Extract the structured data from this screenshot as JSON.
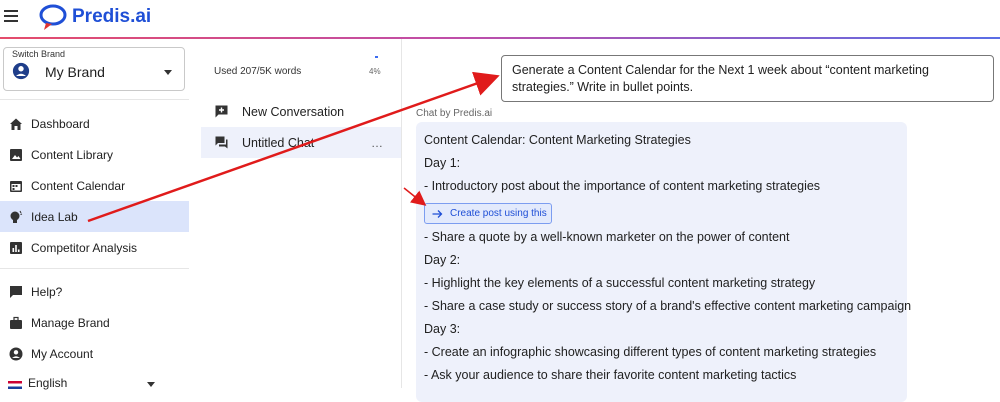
{
  "app": {
    "logo_text": "Predis.ai"
  },
  "brand_switch": {
    "label": "Switch Brand",
    "value": "My Brand"
  },
  "sidebar": {
    "items": [
      {
        "label": "Dashboard",
        "icon": "home-icon"
      },
      {
        "label": "Content Library",
        "icon": "image-library-icon"
      },
      {
        "label": "Content Calendar",
        "icon": "calendar-icon"
      },
      {
        "label": "Idea Lab",
        "icon": "lightbulb-icon",
        "active": true
      },
      {
        "label": "Competitor Analysis",
        "icon": "analytics-icon"
      },
      {
        "label": "Help?",
        "icon": "help-chat-icon"
      },
      {
        "label": "Manage Brand",
        "icon": "briefcase-icon"
      },
      {
        "label": "My Account",
        "icon": "account-icon"
      }
    ],
    "language": "English"
  },
  "chat_list": {
    "usage_text": "Used 207/5K words",
    "usage_percent": "4%",
    "new_conversation": "New Conversation",
    "items": [
      {
        "label": "Untitled Chat",
        "more": "…"
      }
    ]
  },
  "chat": {
    "prompt": "Generate a Content Calendar for the Next 1 week about “content marketing strategies.” Write in bullet points.",
    "response_label": "Chat by Predis.ai",
    "create_post_label": "Create post using this",
    "response_lines": [
      "Content Calendar: Content Marketing Strategies",
      "Day 1:",
      "- Introductory post about the importance of content marketing strategies",
      "- Share a quote by a well-known marketer on the power of content",
      "Day 2:",
      "- Highlight the key elements of a successful content marketing strategy",
      "- Share a case study or success story of a brand's effective content marketing campaign",
      "Day 3:",
      "- Create an infographic showcasing different types of content marketing strategies",
      "- Ask your audience to share their favorite content marketing tactics"
    ]
  },
  "colors": {
    "accent": "#1f4fd6",
    "active_nav": "#dbe4fb",
    "response_bg": "#eef1fb",
    "annotation_arrow": "#e01b1b"
  }
}
